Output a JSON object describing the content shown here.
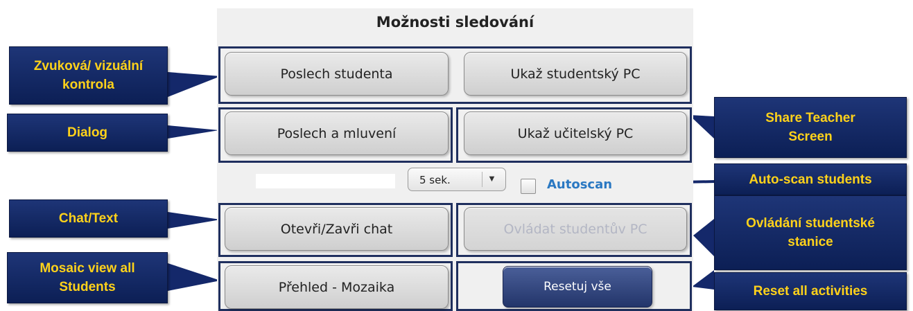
{
  "panel": {
    "title": "Možnosti sledování"
  },
  "buttons": {
    "listen_student": "Poslech studenta",
    "show_student_pc": "Ukaž studentský PC",
    "listen_speak": "Poslech a mluvení",
    "show_teacher_pc": "Ukaž učitelský PC",
    "chat": "Otevři/Zavři chat",
    "control_student_pc": "Ovládat studentův PC",
    "mosaic": "Přehled - Mozaika",
    "reset": "Resetuj vše"
  },
  "autoscan": {
    "interval": "5 sek.",
    "arrow": "▼",
    "label": "Autoscan",
    "checked": false
  },
  "callouts": {
    "audio_visual": "Zvuková/ vizuální kontrola",
    "dialog": "Dialog",
    "chat_text": "Chat/Text",
    "mosaic": "Mosaic view all Students",
    "share_teacher": "Share Teacher Screen",
    "auto_scan": "Auto-scan students",
    "control_station": "Ovládání studentské stanice",
    "reset_all": "Reset all activities"
  },
  "colors": {
    "callout_bg": "#12286a",
    "callout_text": "#ffd21a",
    "frame": "#1f2f5e",
    "autoscan_label": "#2a78c2",
    "reset_button": "#2d407a"
  }
}
